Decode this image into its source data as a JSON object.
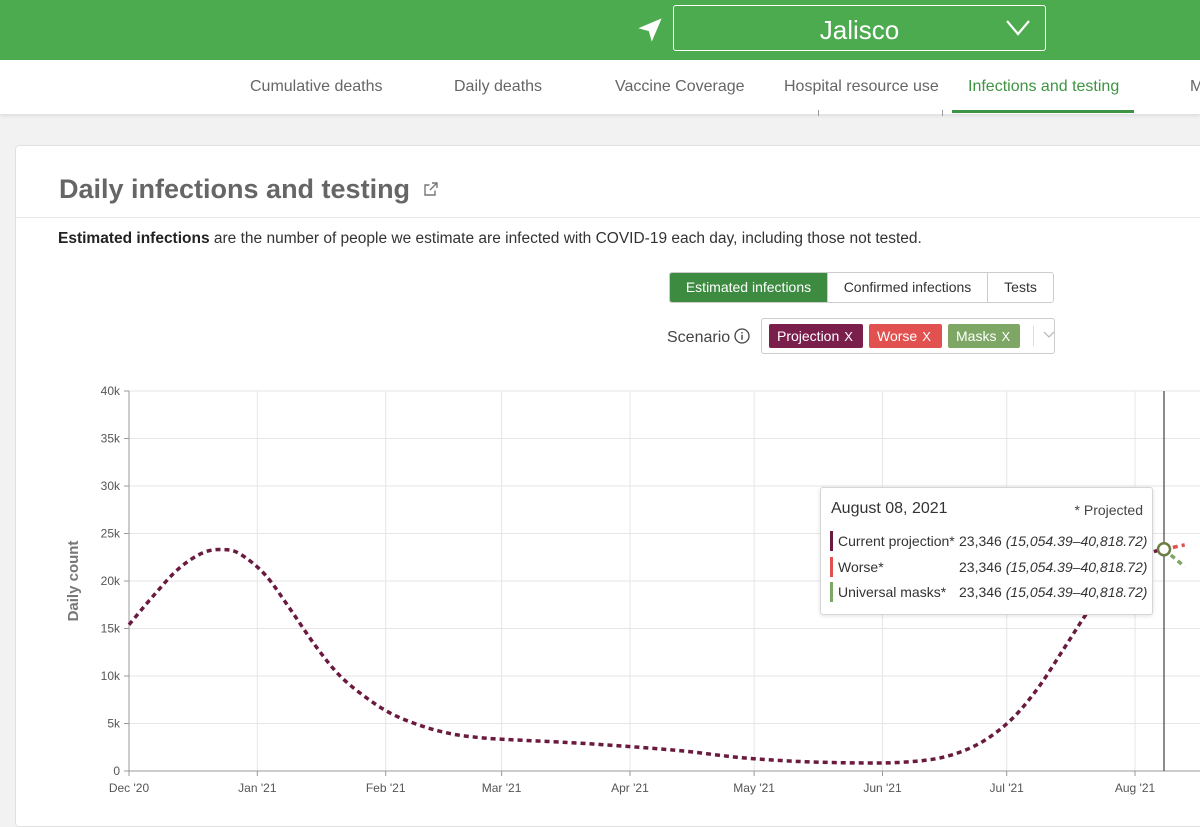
{
  "header": {
    "location": "Jalisco",
    "icons": {
      "location": "navigation-arrow-icon",
      "dropdown": "chevron-down-icon"
    }
  },
  "tabs": [
    {
      "label": "Cumulative deaths",
      "active": false
    },
    {
      "label": "Daily deaths",
      "active": false
    },
    {
      "label": "Vaccine Coverage",
      "active": false
    },
    {
      "label": "Hospital resource use",
      "active": false
    },
    {
      "label": "Infections and testing",
      "active": true
    },
    {
      "label": "M",
      "active": false
    }
  ],
  "card": {
    "title": "Daily infections and testing",
    "description_bold": "Estimated infections",
    "description_rest": " are the number of people we estimate are infected with COVID-19 each day, including those not tested."
  },
  "metric_buttons": [
    {
      "label": "Estimated infections",
      "active": true
    },
    {
      "label": "Confirmed infections",
      "active": false
    },
    {
      "label": "Tests",
      "active": false
    }
  ],
  "scenario": {
    "label": "Scenario",
    "tags": [
      {
        "label": "Projection",
        "remove": "X",
        "color": "#7a1f4b"
      },
      {
        "label": "Worse",
        "remove": "X",
        "color": "#e0514f"
      },
      {
        "label": "Masks",
        "remove": "X",
        "color": "#7ea765"
      }
    ]
  },
  "tooltip": {
    "date": "August 08, 2021",
    "projected_note": "* Projected",
    "rows": [
      {
        "name": "Current projection*",
        "value": "23,346",
        "range": "(15,054.39–40,818.72)",
        "color": "#6b1a3f"
      },
      {
        "name": "Worse*",
        "value": "23,346",
        "range": "(15,054.39–40,818.72)",
        "color": "#e0514f"
      },
      {
        "name": "Universal masks*",
        "value": "23,346",
        "range": "(15,054.39–40,818.72)",
        "color": "#7ea765"
      }
    ]
  },
  "chart_data": {
    "type": "line",
    "ylabel": "Daily count",
    "ylim": [
      0,
      40000
    ],
    "yticks": [
      0,
      5000,
      10000,
      15000,
      20000,
      25000,
      30000,
      35000,
      40000
    ],
    "ytick_labels": [
      "0",
      "5k",
      "10k",
      "15k",
      "20k",
      "25k",
      "30k",
      "35k",
      "40k"
    ],
    "xlim": [
      "2020-12-01",
      "2021-08-13"
    ],
    "xticks": [
      "2020-12-01",
      "2021-01-01",
      "2021-02-01",
      "2021-03-01",
      "2021-04-01",
      "2021-05-01",
      "2021-06-01",
      "2021-07-01",
      "2021-08-01"
    ],
    "xtick_labels": [
      "Dec '20",
      "Jan '21",
      "Feb '21",
      "Mar '21",
      "Apr '21",
      "May '21",
      "Jun '21",
      "Jul '21",
      "Aug '21"
    ],
    "hover_date": "2021-08-08",
    "grid": true,
    "series": [
      {
        "name": "Current projection",
        "color": "#6b1a3f",
        "x": [
          "2020-12-01",
          "2020-12-07",
          "2020-12-13",
          "2020-12-19",
          "2020-12-24",
          "2020-12-28",
          "2021-01-03",
          "2021-01-09",
          "2021-01-15",
          "2021-01-21",
          "2021-01-28",
          "2021-02-03",
          "2021-02-10",
          "2021-02-17",
          "2021-02-24",
          "2021-03-03",
          "2021-03-17",
          "2021-03-31",
          "2021-04-14",
          "2021-04-28",
          "2021-05-12",
          "2021-05-26",
          "2021-06-05",
          "2021-06-14",
          "2021-06-21",
          "2021-06-27",
          "2021-07-03",
          "2021-07-09",
          "2021-07-15",
          "2021-07-21",
          "2021-07-28",
          "2021-08-04",
          "2021-08-08"
        ],
        "y": [
          15400,
          18500,
          21300,
          23000,
          23300,
          22800,
          20600,
          17000,
          13200,
          10000,
          7500,
          5900,
          4700,
          3900,
          3500,
          3300,
          3000,
          2600,
          2100,
          1400,
          1000,
          850,
          900,
          1300,
          2200,
          3600,
          5800,
          9000,
          13000,
          17000,
          20800,
          22800,
          23346
        ]
      },
      {
        "name": "Worse",
        "color": "#e0514f",
        "x": [
          "2021-08-08",
          "2021-08-13"
        ],
        "y": [
          23346,
          23800
        ]
      },
      {
        "name": "Universal masks",
        "color": "#7ea765",
        "x": [
          "2021-08-08",
          "2021-08-13"
        ],
        "y": [
          23346,
          21500
        ]
      }
    ]
  }
}
